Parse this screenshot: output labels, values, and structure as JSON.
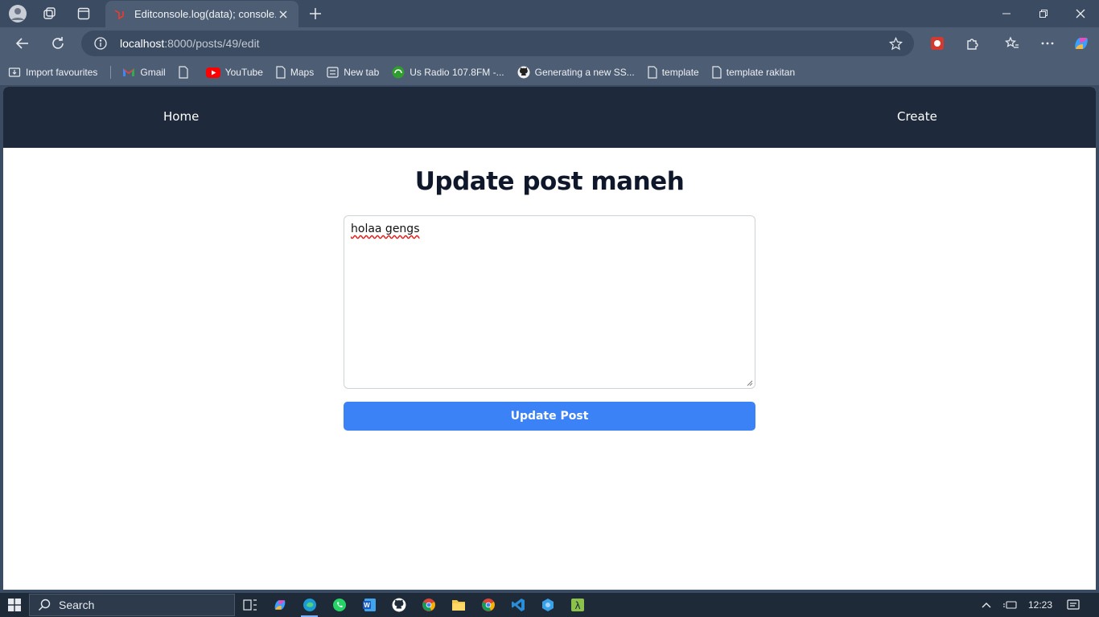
{
  "browser": {
    "tab_title": "Editconsole.log(data); console.log",
    "address_host": "localhost",
    "address_path": ":8000/posts/49/edit",
    "bookmarks": [
      {
        "label": "Import favourites",
        "icon": "import-icon"
      },
      {
        "label": "Gmail",
        "icon": "gmail-icon"
      },
      {
        "label": "",
        "icon": "page-icon"
      },
      {
        "label": "YouTube",
        "icon": "youtube-icon"
      },
      {
        "label": "Maps",
        "icon": "page-icon"
      },
      {
        "label": "New tab",
        "icon": "newtab-icon"
      },
      {
        "label": "Us Radio 107.8FM -...",
        "icon": "radio-icon"
      },
      {
        "label": "Generating a new SS...",
        "icon": "github-icon"
      },
      {
        "label": "template",
        "icon": "page-icon"
      },
      {
        "label": "template rakitan",
        "icon": "page-icon"
      }
    ]
  },
  "site": {
    "nav_home": "Home",
    "nav_create": "Create",
    "page_title": "Update post maneh",
    "body_value": "holaa gengs",
    "submit_label": "Update Post"
  },
  "taskbar": {
    "search_placeholder": "Search",
    "clock": "12:23"
  },
  "colors": {
    "nav_bg": "#1e293b",
    "button_bg": "#3b82f6",
    "chrome_bg": "#4d5d73"
  }
}
